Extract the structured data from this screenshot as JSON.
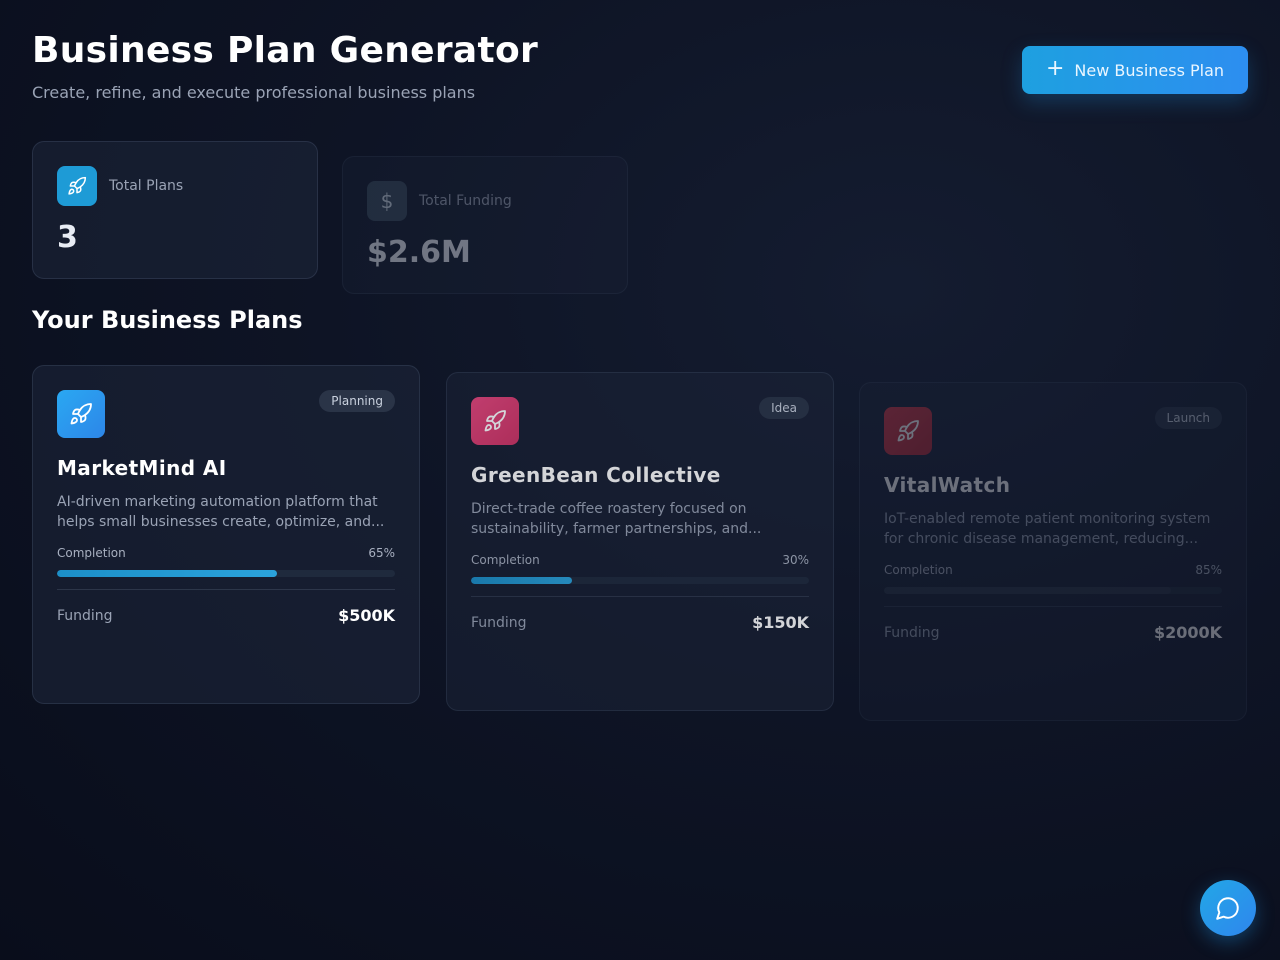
{
  "header": {
    "title": "Business Plan Generator",
    "subtitle": "Create, refine, and execute professional business plans",
    "new_button_label": "New Business Plan"
  },
  "stats": [
    {
      "label": "Total Plans",
      "value": "3",
      "icon": "rocket-icon",
      "color": "#1e9bd6"
    },
    {
      "label": "Total Funding",
      "value": "$2.6M",
      "icon": "dollar-icon",
      "color": "#3a4c5e"
    }
  ],
  "section_title": "Your Business Plans",
  "plans": [
    {
      "name": "MarketMind AI",
      "status": "Planning",
      "description": "AI-driven marketing automation platform that helps small businesses create, optimize, and...",
      "completion_label": "Completion",
      "completion": "65%",
      "completion_value": 0.65,
      "funding_label": "Funding",
      "funding": "$500K",
      "icon": "rocket-icon",
      "color": "#2a9ff0"
    },
    {
      "name": "GreenBean Collective",
      "status": "Idea",
      "description": "Direct-trade coffee roastery focused on sustainability, farmer partnerships, and...",
      "completion_label": "Completion",
      "completion": "30%",
      "completion_value": 0.3,
      "funding_label": "Funding",
      "funding": "$150K",
      "icon": "rocket-icon",
      "color": "#e0407a"
    },
    {
      "name": "VitalWatch",
      "status": "Launch",
      "description": "IoT-enabled remote patient monitoring system for chronic disease management, reducing...",
      "completion_label": "Completion",
      "completion": "85%",
      "completion_value": 0.85,
      "funding_label": "Funding",
      "funding": "$2000K",
      "icon": "rocket-icon",
      "color": "#c2303e"
    }
  ],
  "chat_icon": "chat-bubble-icon"
}
